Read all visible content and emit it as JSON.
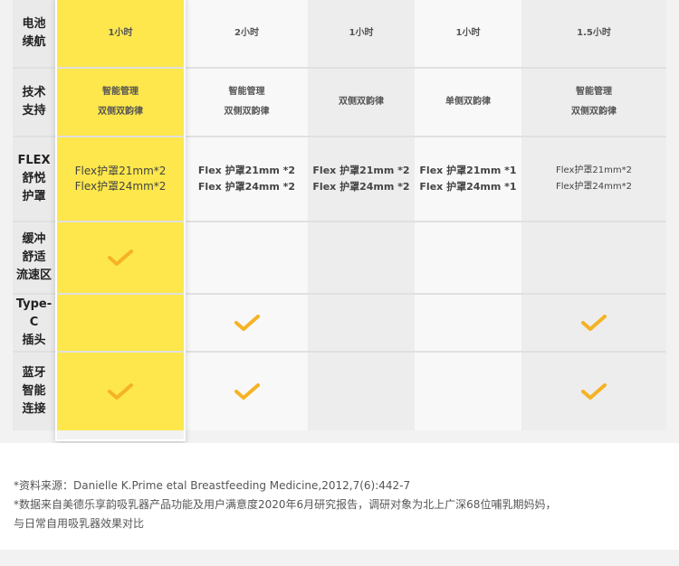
{
  "rows": [
    {
      "label": [
        "电池",
        "续航"
      ],
      "cells": [
        "1小时",
        "2小时",
        "1小时",
        "1小时",
        "1.5小时"
      ]
    },
    {
      "label": [
        "技术",
        "支持"
      ],
      "cells": [
        [
          "智能管理",
          "双侧双韵律"
        ],
        [
          "智能管理",
          "双侧双韵律"
        ],
        [
          "双侧双韵律"
        ],
        [
          "单侧双韵律"
        ],
        [
          "智能管理",
          "双侧双韵律"
        ]
      ]
    },
    {
      "label": [
        "FLEX",
        "舒悦",
        "护罩"
      ],
      "cells": [
        [
          "Flex护罩21mm*2",
          "Flex护罩24mm*2"
        ],
        [
          "Flex 护罩21mm *2",
          "Flex 护罩24mm *2"
        ],
        [
          "Flex 护罩21mm *2",
          "Flex 护罩24mm *2"
        ],
        [
          "Flex 护罩21mm *1",
          "Flex 护罩24mm *1"
        ],
        [
          "Flex护罩21mm*2",
          "Flex护罩24mm*2"
        ]
      ]
    },
    {
      "label": [
        "缓冲",
        "舒适",
        "流速区"
      ],
      "checks": [
        true,
        false,
        false,
        false,
        false
      ]
    },
    {
      "label": [
        "Type-C",
        "插头"
      ],
      "checks": [
        false,
        true,
        false,
        false,
        true
      ]
    },
    {
      "label": [
        "蓝牙",
        "智能",
        "连接"
      ],
      "checks": [
        true,
        true,
        false,
        false,
        true
      ]
    }
  ],
  "notes": {
    "line1": "*资料来源：Danielle K.Prime etal Breastfeeding Medicine,2012,7(6):442-7",
    "line2": "*数据来自美德乐享韵吸乳器产品功能及用户满意度2020年6月研究报告，调研对象为北上广深68位哺乳期妈妈，",
    "line3": "与日常自用吸乳器效果对比"
  },
  "colors": {
    "highlight": "#fde74c",
    "check": "#f5b324"
  }
}
